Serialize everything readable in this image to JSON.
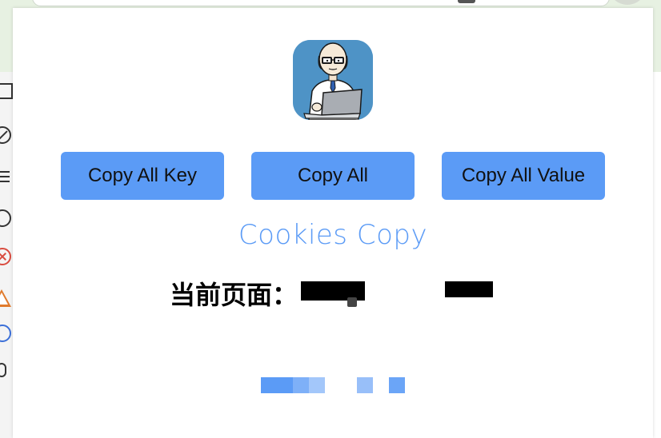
{
  "popup": {
    "logo_icon": "developer-with-laptop-icon",
    "buttons": {
      "copy_all_key": "Copy All Key",
      "copy_all": "Copy All",
      "copy_all_value": "Copy All Value"
    },
    "title": "Cookies Copy",
    "current_page_label": "当前页面：",
    "accent_color": "#5b9bf6"
  },
  "background": {
    "sidebar_icons": [
      "panel-icon",
      "block-icon",
      "list-icon",
      "account-icon",
      "error-icon",
      "warning-icon",
      "info-icon",
      "bug-icon"
    ]
  }
}
